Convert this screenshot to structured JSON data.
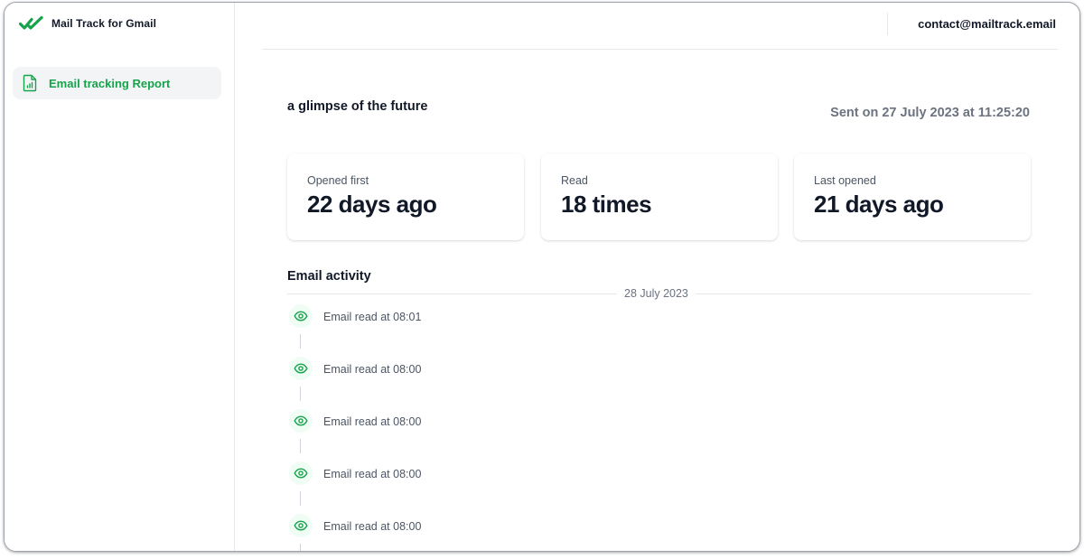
{
  "app": {
    "name": "Mail Track for Gmail"
  },
  "sidebar": {
    "items": [
      {
        "label": "Email tracking Report"
      }
    ]
  },
  "header": {
    "email": "contact@mailtrack.email"
  },
  "report": {
    "subject": "a glimpse of the future",
    "sent_on": "Sent on 27 July 2023 at 11:25:20",
    "stats": [
      {
        "label": "Opened first",
        "value": "22 days ago"
      },
      {
        "label": "Read",
        "value": "18 times"
      },
      {
        "label": "Last opened",
        "value": "21 days ago"
      }
    ],
    "activity": {
      "title": "Email activity",
      "date": "28 July 2023",
      "events": [
        {
          "text": "Email read at 08:01",
          "icon": "eye-icon"
        },
        {
          "text": "Email read at 08:00",
          "icon": "eye-icon"
        },
        {
          "text": "Email read at 08:00",
          "icon": "eye-icon"
        },
        {
          "text": "Email read at 08:00",
          "icon": "eye-icon"
        },
        {
          "text": "Email read at 08:00",
          "icon": "eye-icon"
        }
      ]
    }
  },
  "colors": {
    "brand_green": "#16a34a",
    "icon_bg": "#f0fdf4",
    "muted_text": "#6b7280",
    "border": "#e5e7eb"
  }
}
